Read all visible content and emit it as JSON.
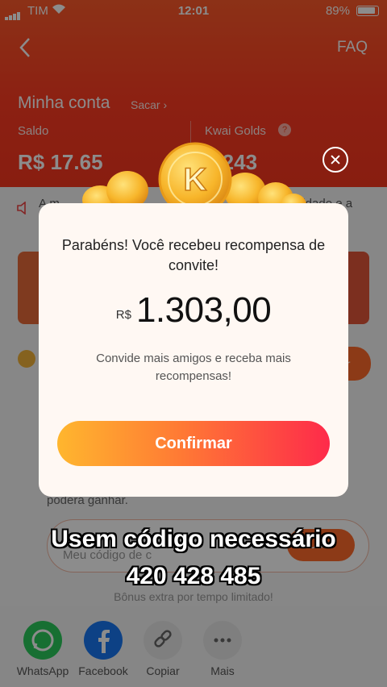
{
  "status_bar": {
    "carrier": "TIM",
    "time": "12:01",
    "battery": "89%"
  },
  "header": {
    "faq": "FAQ",
    "account_title": "Minha conta",
    "withdraw": "Sacar ›",
    "balance_label": "Saldo",
    "balance_value": "R$ 17.65",
    "golds_label": "Kwai Golds",
    "golds_value": "6 243"
  },
  "notice": {
    "text_left": "A m",
    "text_right": "lidade e a"
  },
  "side_button": "ar",
  "background_form": {
    "earn_text": "poderá ganhar.",
    "code_placeholder": "Meu código de c",
    "code_button": "Usar",
    "bonus_text": "Bônus extra por tempo limitado!"
  },
  "share": [
    {
      "label": "WhatsApp",
      "icon": "whatsapp-icon"
    },
    {
      "label": "Facebook",
      "icon": "facebook-icon"
    },
    {
      "label": "Copiar",
      "icon": "link-icon"
    },
    {
      "label": "Mais",
      "icon": "more-icon"
    }
  ],
  "modal": {
    "title": "Parabéns! Você recebeu recompensa de convite!",
    "currency": "R$",
    "amount": "1.303,00",
    "subtitle": "Convide mais amigos e receba mais recompensas!",
    "confirm": "Confirmar"
  },
  "caption": {
    "line1": "Usem código necessário",
    "line2": "420 428 485"
  },
  "colors": {
    "header": "#ff4a26",
    "confirm_start": "#ffb62e",
    "confirm_end": "#fe2a4a"
  }
}
